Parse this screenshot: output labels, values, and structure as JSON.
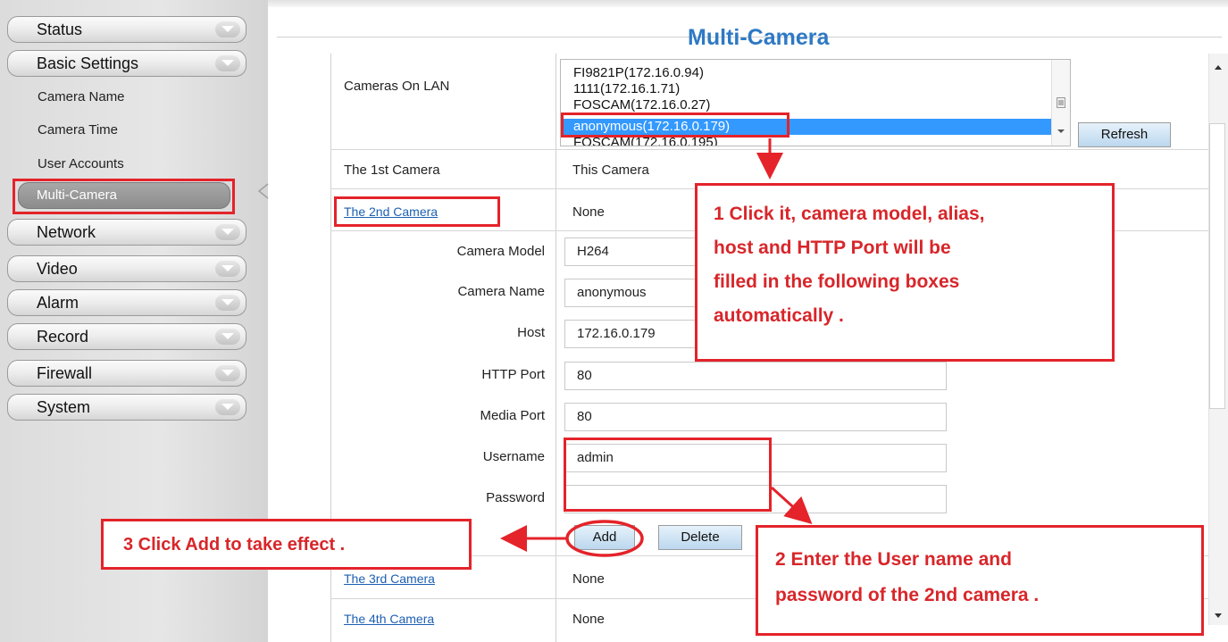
{
  "sidebar": {
    "menu": [
      {
        "label": "Status"
      },
      {
        "label": "Basic Settings"
      },
      {
        "label": "Network"
      },
      {
        "label": "Video"
      },
      {
        "label": "Alarm"
      },
      {
        "label": "Record"
      },
      {
        "label": "Firewall"
      },
      {
        "label": "System"
      }
    ],
    "submenu": [
      {
        "label": "Camera Name"
      },
      {
        "label": "Camera Time"
      },
      {
        "label": "User Accounts"
      },
      {
        "label": "Multi-Camera"
      }
    ]
  },
  "page": {
    "title": "Multi-Camera",
    "cameras_on_lan_label": "Cameras On LAN",
    "lan_list": [
      "FI9821P(172.16.0.94)",
      "1111(172.16.1.71)",
      "FOSCAM(172.16.0.27)",
      "anonymous(172.16.0.179)",
      "FOSCAM(172.16.0.195)"
    ],
    "selected_lan_item": "anonymous(172.16.0.179)",
    "refresh_label": "Refresh",
    "first_camera_label": "The 1st Camera",
    "first_camera_value": "This Camera",
    "second_camera_label": "The 2nd Camera",
    "second_camera_value": "None",
    "fields": {
      "camera_model": {
        "label": "Camera Model",
        "value": "H264"
      },
      "camera_name": {
        "label": "Camera Name",
        "value": "anonymous"
      },
      "host": {
        "label": "Host",
        "value": "172.16.0.179"
      },
      "http_port": {
        "label": "HTTP Port",
        "value": "80"
      },
      "media_port": {
        "label": "Media Port",
        "value": "80"
      },
      "username": {
        "label": "Username",
        "value": "admin"
      },
      "password": {
        "label": "Password",
        "value": ""
      }
    },
    "add_label": "Add",
    "delete_label": "Delete",
    "third_camera_label": "The 3rd Camera",
    "third_camera_value": "None",
    "fourth_camera_label": "The 4th Camera",
    "fourth_camera_value": "None"
  },
  "annotations": {
    "callout1_lines": [
      "1 Click it, camera model, alias,",
      "host and HTTP Port will be",
      "filled in the following boxes",
      "automatically ."
    ],
    "callout2_lines": [
      "2 Enter the User name and",
      "password of the 2nd camera ."
    ],
    "callout3": "3 Click Add to take effect .",
    "highlight_color": "#e4232a"
  },
  "colors": {
    "title": "#2e79c4",
    "link": "#1d5fb2",
    "list_selection": "#3399ff"
  }
}
